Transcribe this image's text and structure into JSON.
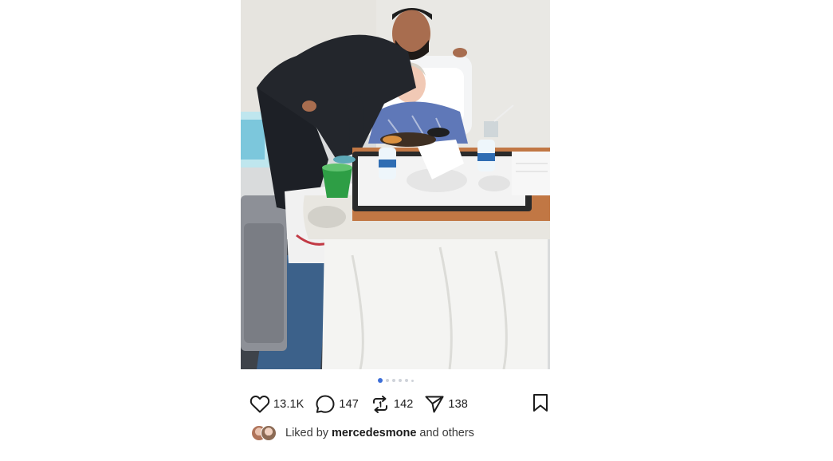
{
  "post": {
    "carousel": {
      "total_images": 6,
      "active_index": 1
    },
    "actions": {
      "likes": "13.1K",
      "comments": "147",
      "reposts": "142",
      "shares": "138"
    },
    "liked_by": {
      "prefix": "Liked by",
      "username": "mercedesmone",
      "suffix": "and others"
    },
    "icons": {
      "like": "heart-icon",
      "comment": "comment-bubble-icon",
      "repost": "repost-icon",
      "share": "send-icon",
      "save": "bookmark-icon"
    }
  }
}
